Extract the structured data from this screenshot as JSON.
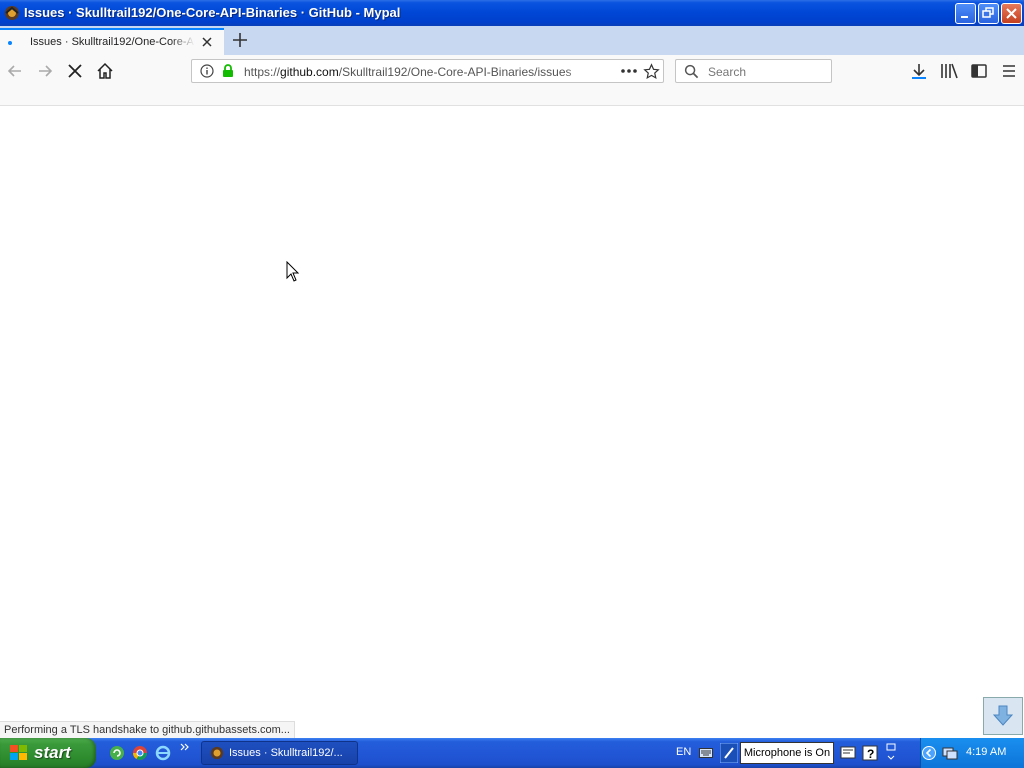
{
  "window": {
    "title": "Issues · Skulltrail192/One-Core-API-Binaries · GitHub - Mypal"
  },
  "tab": {
    "title": "Issues · Skulltrail192/One-Core-API-Binaries · GitHub"
  },
  "urlbar": {
    "prefix": "https://",
    "host": "github.com",
    "path": "/Skulltrail192/One-Core-API-Binaries/issues"
  },
  "searchbar": {
    "placeholder": "Search"
  },
  "status": {
    "text": "Performing a TLS handshake to github.githubassets.com..."
  },
  "taskbar": {
    "start_label": "start",
    "task_button_label": "Issues · Skulltrail192/...",
    "language": "EN",
    "mic_tooltip": "Microphone is On",
    "clock": "4:19 AM"
  },
  "colors": {
    "titlebar_blue": "#0046d6",
    "taskbar_blue": "#245edb",
    "start_green": "#3a9a3a",
    "tab_accent": "#0a84ff"
  },
  "icons": [
    "back-icon",
    "forward-icon",
    "stop-icon",
    "home-icon",
    "info-icon",
    "lock-icon",
    "page-actions-icon",
    "bookmark-star-icon",
    "search-icon",
    "download-icon",
    "library-icon",
    "sidebar-icon",
    "menu-icon"
  ]
}
